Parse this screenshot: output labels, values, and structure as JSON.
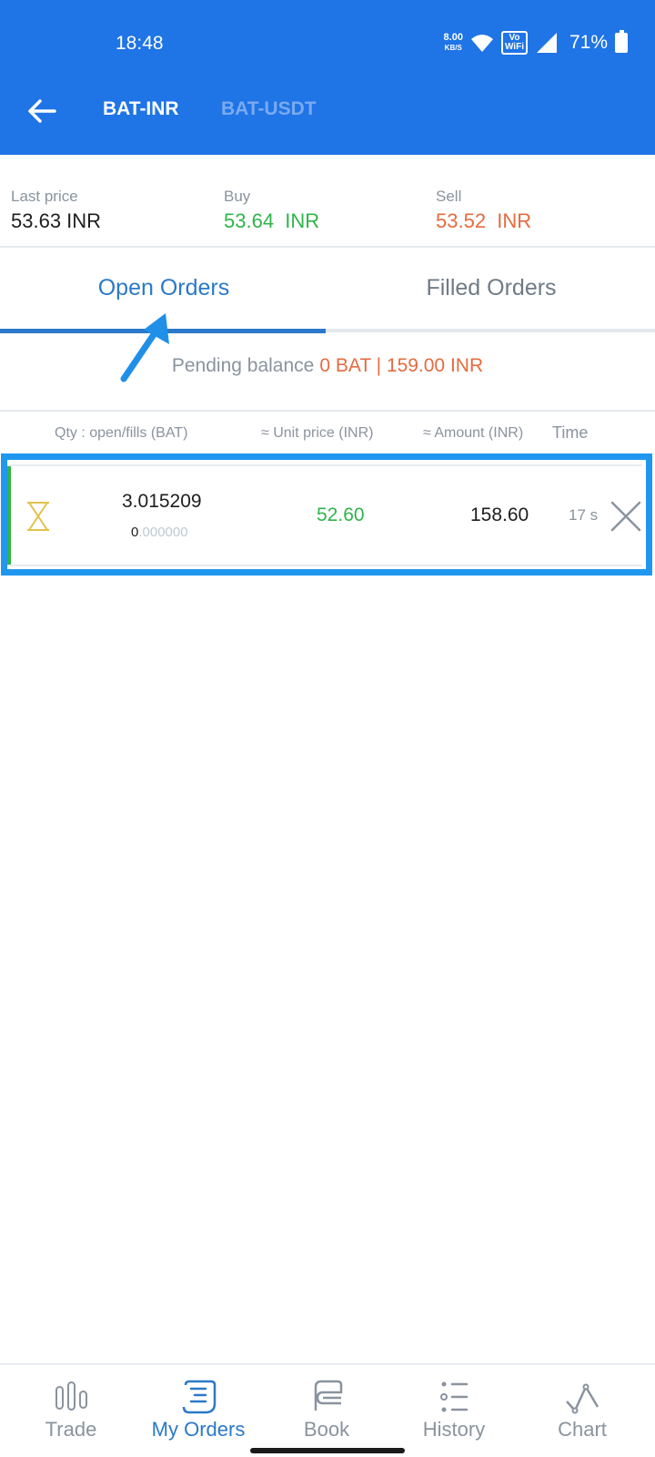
{
  "status_bar": {
    "time": "18:48",
    "net_speed": "8.00",
    "net_unit": "KB/S",
    "volte_top": "Vo",
    "volte_bottom": "WiFi",
    "battery": "71%"
  },
  "header": {
    "pairs": [
      {
        "label": "BAT-INR",
        "active": true
      },
      {
        "label": "BAT-USDT",
        "active": false
      }
    ]
  },
  "prices": {
    "last_label": "Last price",
    "last_value": "53.63 INR",
    "buy_label": "Buy",
    "buy_value": "53.64  INR",
    "sell_label": "Sell",
    "sell_value": "53.52  INR"
  },
  "tabs": {
    "open": "Open Orders",
    "filled": "Filled Orders"
  },
  "pending": {
    "label": "Pending balance",
    "value": "0 BAT | 159.00 INR"
  },
  "table": {
    "headers": {
      "qty": "Qty : open/fills (BAT)",
      "unit": "≈ Unit price (INR)",
      "amount": "≈ Amount (INR)",
      "time": "Time"
    },
    "rows": [
      {
        "qty_open": "3.015209",
        "qty_fill_lead": "0",
        "qty_fill_rest": ".000000",
        "unit_price": "52.60",
        "amount": "158.60",
        "time": "17 s"
      }
    ]
  },
  "bottom_nav": {
    "items": [
      {
        "label": "Trade",
        "icon": "candlestick-icon"
      },
      {
        "label": "My Orders",
        "icon": "orders-icon",
        "active": true
      },
      {
        "label": "Book",
        "icon": "book-icon"
      },
      {
        "label": "History",
        "icon": "history-icon"
      },
      {
        "label": "Chart",
        "icon": "chart-icon"
      }
    ]
  },
  "colors": {
    "brand": "#1f74e6",
    "buy": "#2fb44a",
    "sell": "#e56b3f",
    "accent": "#2b79c8",
    "highlight": "#1f97ef"
  }
}
